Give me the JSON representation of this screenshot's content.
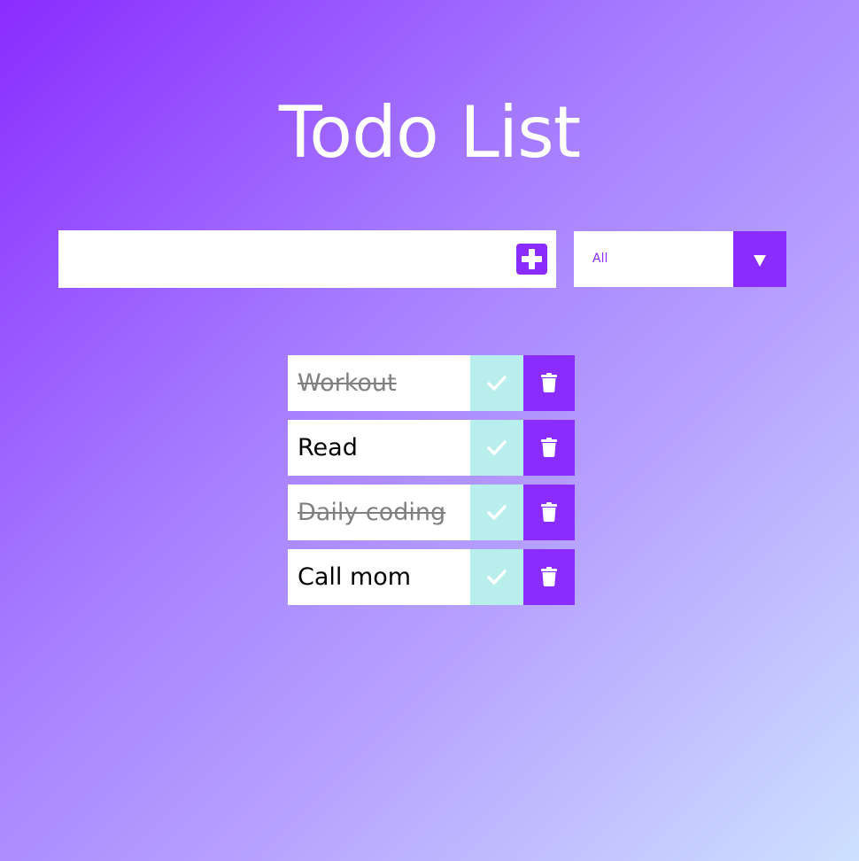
{
  "header": {
    "title": "Todo List"
  },
  "form": {
    "input_value": "",
    "input_placeholder": "",
    "add_icon": "plus-square-icon",
    "filter_selected": "All",
    "filter_icon": "caret-down-icon"
  },
  "todos": [
    {
      "text": "Workout",
      "completed": true
    },
    {
      "text": "Read",
      "completed": false
    },
    {
      "text": "Daily coding",
      "completed": true
    },
    {
      "text": "Call mom",
      "completed": false
    }
  ],
  "icons": {
    "check": "check-icon",
    "trash": "trash-icon"
  },
  "colors": {
    "accent": "#8b2cff",
    "check_bg": "#b8eeec",
    "completed_text": "#808080",
    "gradient_start": "#8a2cff",
    "gradient_end": "#cde0ff"
  }
}
